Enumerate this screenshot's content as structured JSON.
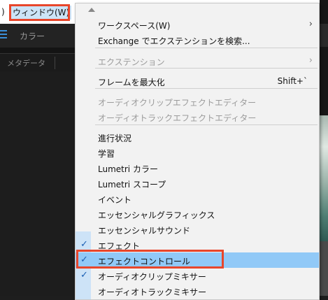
{
  "menubar": {
    "prev_menu_fragment": ")",
    "window_menu_label": "ウィンドウ(W)"
  },
  "panel": {
    "color_tab_label": "カラー",
    "metadata_tab_label": "メタデータ"
  },
  "window_menu": {
    "items": [
      {
        "label": "ワークスペース(W)",
        "submenu": true,
        "enabled": true
      },
      {
        "label": "Exchange でエクステンションを検索...",
        "enabled": true
      },
      {
        "label": "エクステンション",
        "submenu": true,
        "enabled": false
      },
      {
        "label": "フレームを最大化",
        "shortcut": "Shift+`",
        "enabled": true
      },
      {
        "label": "オーディオクリップエフェクトエディター",
        "enabled": false
      },
      {
        "label": "オーディオトラックエフェクトエディター",
        "enabled": false
      },
      {
        "label": "進行状況",
        "enabled": true
      },
      {
        "label": "学習",
        "enabled": true
      },
      {
        "label": "Lumetri カラー",
        "enabled": true
      },
      {
        "label": "Lumetri スコープ",
        "enabled": true
      },
      {
        "label": "イベント",
        "enabled": true
      },
      {
        "label": "エッセンシャルグラフィックス",
        "enabled": true
      },
      {
        "label": "エッセンシャルサウンド",
        "enabled": true
      },
      {
        "label": "エフェクト",
        "checked": true,
        "enabled": true
      },
      {
        "label": "エフェクトコントロール",
        "checked": true,
        "selected": true,
        "enabled": true
      },
      {
        "label": "オーディオクリップミキサー",
        "checked": true,
        "enabled": true
      },
      {
        "label": "オーディオトラックミキサー",
        "enabled": true
      }
    ],
    "submenu_glyph": "›",
    "check_glyph": "✓"
  },
  "colors": {
    "highlight_box": "#e8462b",
    "selected_row": "#91c9f7",
    "check": "#1a5fb4"
  }
}
